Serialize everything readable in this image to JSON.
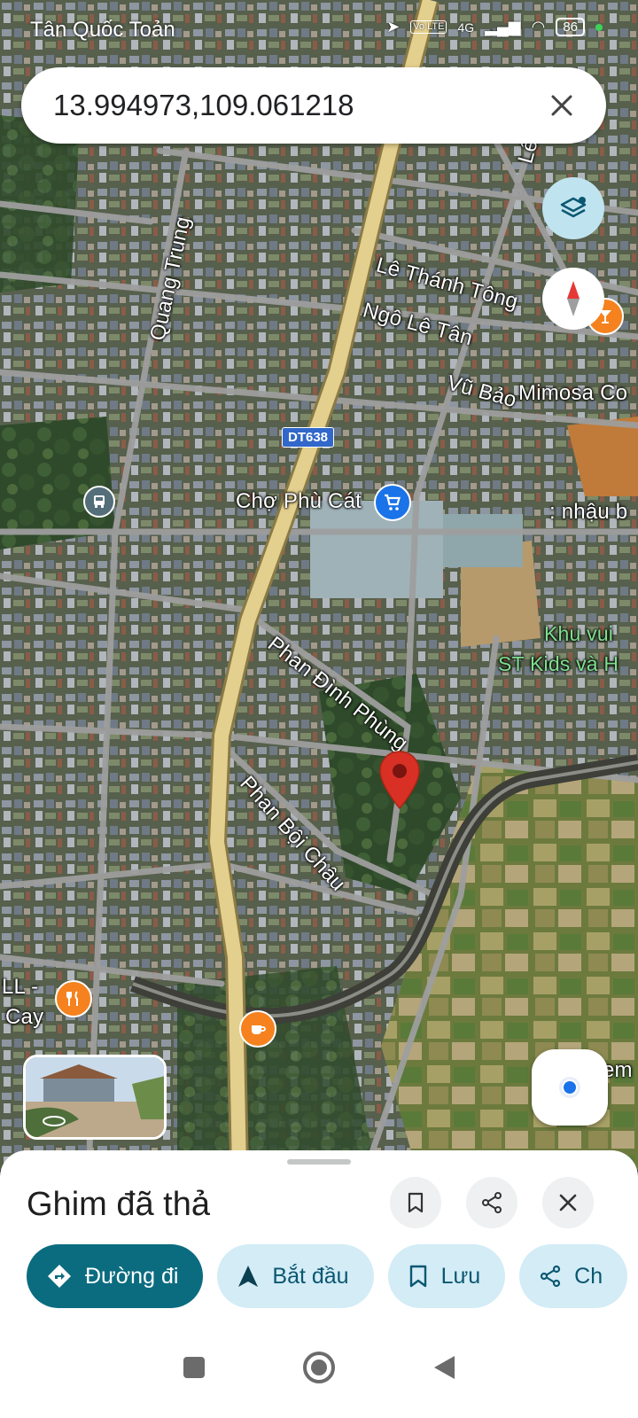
{
  "status_bar": {
    "left_text": "Tân Quốc Toản",
    "network": "4G",
    "volte": "Vo LTE",
    "battery": "86"
  },
  "search": {
    "value": "13.994973,109.061218"
  },
  "map": {
    "streets": {
      "le_lai": "Lê L",
      "le_thanh_tong": "Lê Thánh Tông",
      "ngo_le_tan": "Ngô Lê Tân",
      "vu_bao": "Vũ Bảo",
      "quang_trung": "Quang Trung",
      "phan_dinh_phung": "Phan Đình Phùng",
      "phan_boi_chau": "Phan Bội Châu"
    },
    "route_badge": "DT638",
    "places": {
      "market": "Chợ Phù Cát",
      "mimosa": "Mimosa Co",
      "nhau": ": nhậu b",
      "kids_line1": "Khu vui",
      "kids_line2": "ST Kids và H",
      "ll": "LL -",
      "cay": "Cay",
      "em": "em"
    }
  },
  "sheet": {
    "title": "Ghim đã thả",
    "actions": [
      {
        "label": "Đường đi",
        "icon": "directions-icon"
      },
      {
        "label": "Bắt đầu",
        "icon": "navigation-arrow-icon"
      },
      {
        "label": "Lưu",
        "icon": "bookmark-icon"
      },
      {
        "label": "Ch",
        "icon": "share-icon"
      }
    ]
  },
  "colors": {
    "accent": "#0b6c80",
    "chip": "#d3ecf6",
    "pin": "#d93025",
    "poi_orange": "#f5821f",
    "poi_blue": "#1a73e8"
  }
}
